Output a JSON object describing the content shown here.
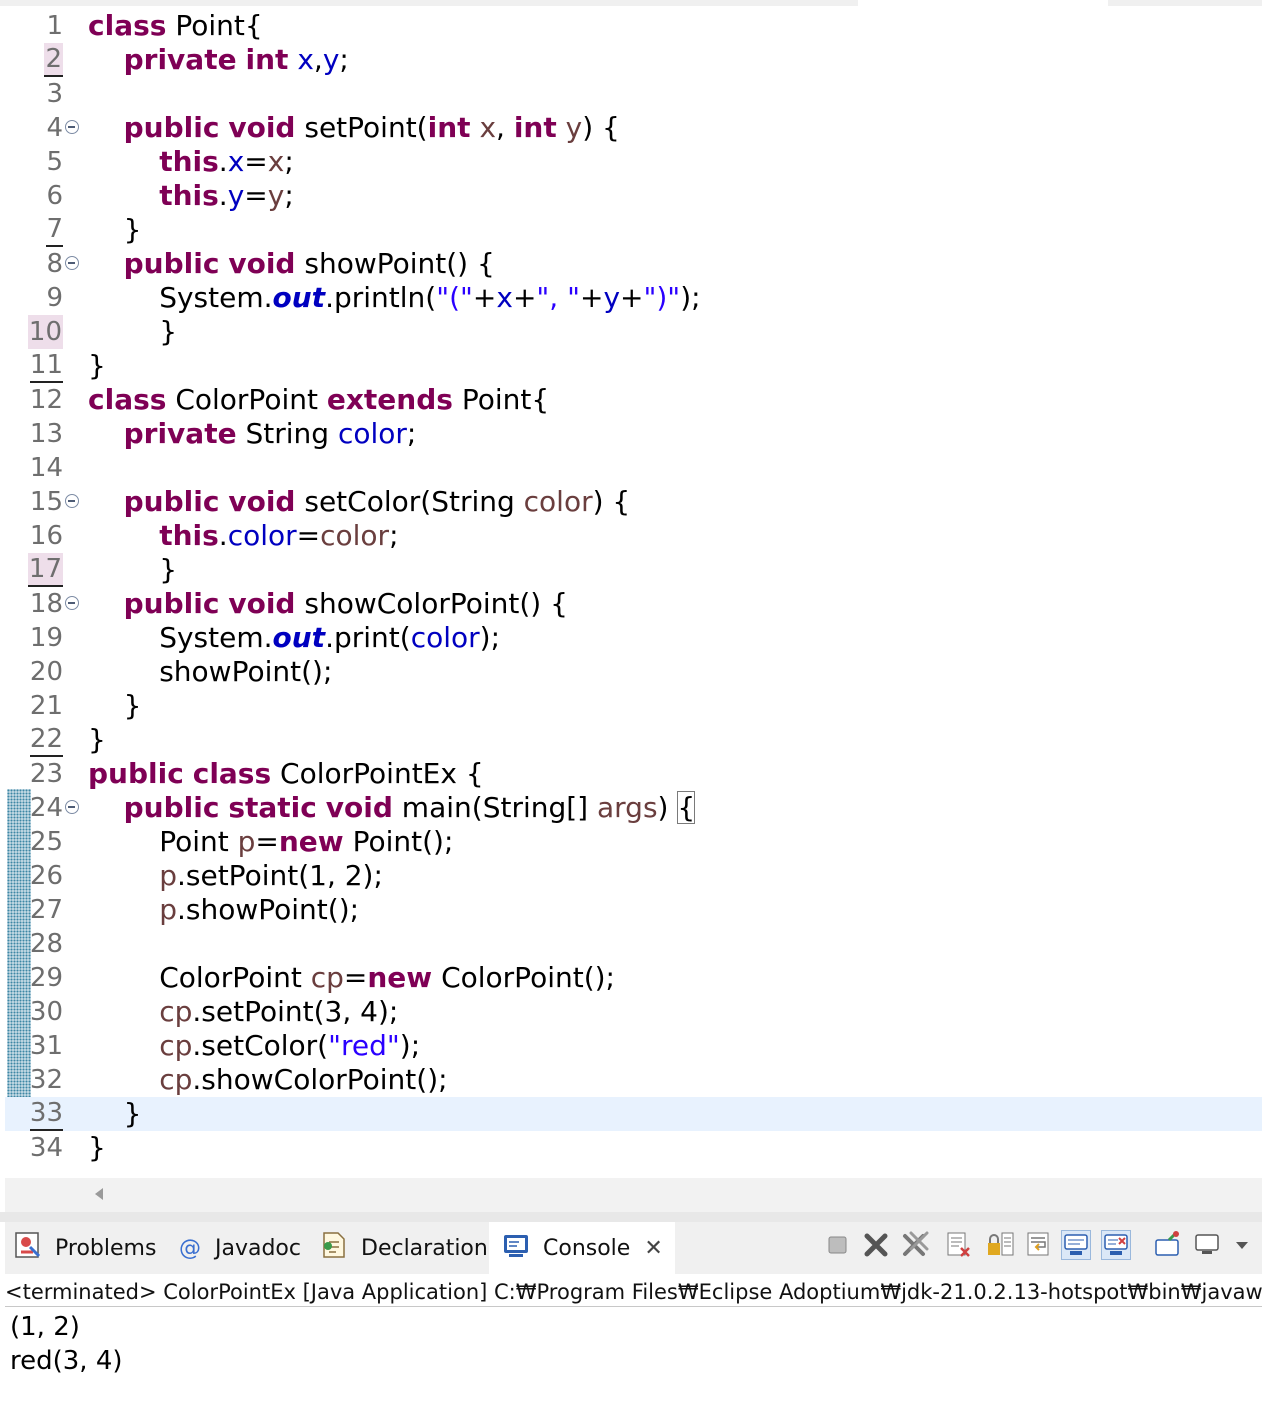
{
  "editor": {
    "current_line": 33,
    "lines": [
      {
        "n": "1",
        "tokens": [
          [
            "kw",
            "class"
          ],
          [
            "p",
            " Point{"
          ]
        ]
      },
      {
        "n": "2",
        "mark": true,
        "ul": true,
        "tokens": [
          [
            "p",
            "    "
          ],
          [
            "kw",
            "private"
          ],
          [
            "p",
            " "
          ],
          [
            "kw",
            "int"
          ],
          [
            "p",
            " "
          ],
          [
            "fld",
            "x"
          ],
          [
            "p",
            ","
          ],
          [
            "fld",
            "y"
          ],
          [
            "p",
            ";"
          ]
        ]
      },
      {
        "n": "3",
        "tokens": []
      },
      {
        "n": "4",
        "fold": true,
        "tokens": [
          [
            "p",
            "    "
          ],
          [
            "kw",
            "public"
          ],
          [
            "p",
            " "
          ],
          [
            "kw",
            "void"
          ],
          [
            "p",
            " setPoint("
          ],
          [
            "kw",
            "int"
          ],
          [
            "p",
            " "
          ],
          [
            "var",
            "x"
          ],
          [
            "p",
            ", "
          ],
          [
            "kw",
            "int"
          ],
          [
            "p",
            " "
          ],
          [
            "var",
            "y"
          ],
          [
            "p",
            ") {"
          ]
        ]
      },
      {
        "n": "5",
        "tokens": [
          [
            "p",
            "        "
          ],
          [
            "kw",
            "this"
          ],
          [
            "p",
            "."
          ],
          [
            "fld",
            "x"
          ],
          [
            "p",
            "="
          ],
          [
            "var",
            "x"
          ],
          [
            "p",
            ";"
          ]
        ]
      },
      {
        "n": "6",
        "tokens": [
          [
            "p",
            "        "
          ],
          [
            "kw",
            "this"
          ],
          [
            "p",
            "."
          ],
          [
            "fld",
            "y"
          ],
          [
            "p",
            "="
          ],
          [
            "var",
            "y"
          ],
          [
            "p",
            ";"
          ]
        ]
      },
      {
        "n": "7",
        "ul": true,
        "tokens": [
          [
            "p",
            "    }"
          ]
        ]
      },
      {
        "n": "8",
        "fold": true,
        "tokens": [
          [
            "p",
            "    "
          ],
          [
            "kw",
            "public"
          ],
          [
            "p",
            " "
          ],
          [
            "kw",
            "void"
          ],
          [
            "p",
            " showPoint() {"
          ]
        ]
      },
      {
        "n": "9",
        "tokens": [
          [
            "p",
            "        System."
          ],
          [
            "sfld",
            "out"
          ],
          [
            "p",
            ".println("
          ],
          [
            "str",
            "\"(\""
          ],
          [
            "p",
            "+"
          ],
          [
            "fld",
            "x"
          ],
          [
            "p",
            "+"
          ],
          [
            "str",
            "\", \""
          ],
          [
            "p",
            "+"
          ],
          [
            "fld",
            "y"
          ],
          [
            "p",
            "+"
          ],
          [
            "str",
            "\")\""
          ],
          [
            "p",
            ");"
          ]
        ]
      },
      {
        "n": "10",
        "mark": true,
        "tokens": [
          [
            "p",
            "        }"
          ]
        ]
      },
      {
        "n": "11",
        "ul": true,
        "tokens": [
          [
            "p",
            "}"
          ]
        ]
      },
      {
        "n": "12",
        "tokens": [
          [
            "kw",
            "class"
          ],
          [
            "p",
            " ColorPoint "
          ],
          [
            "kw",
            "extends"
          ],
          [
            "p",
            " Point{"
          ]
        ]
      },
      {
        "n": "13",
        "tokens": [
          [
            "p",
            "    "
          ],
          [
            "kw",
            "private"
          ],
          [
            "p",
            " String "
          ],
          [
            "fld",
            "color"
          ],
          [
            "p",
            ";"
          ]
        ]
      },
      {
        "n": "14",
        "tokens": []
      },
      {
        "n": "15",
        "fold": true,
        "tokens": [
          [
            "p",
            "    "
          ],
          [
            "kw",
            "public"
          ],
          [
            "p",
            " "
          ],
          [
            "kw",
            "void"
          ],
          [
            "p",
            " setColor(String "
          ],
          [
            "var",
            "color"
          ],
          [
            "p",
            ") {"
          ]
        ]
      },
      {
        "n": "16",
        "tokens": [
          [
            "p",
            "        "
          ],
          [
            "kw",
            "this"
          ],
          [
            "p",
            "."
          ],
          [
            "fld",
            "color"
          ],
          [
            "p",
            "="
          ],
          [
            "var",
            "color"
          ],
          [
            "p",
            ";"
          ]
        ]
      },
      {
        "n": "17",
        "mark": true,
        "ul": true,
        "tokens": [
          [
            "p",
            "        }"
          ]
        ]
      },
      {
        "n": "18",
        "fold": true,
        "tokens": [
          [
            "p",
            "    "
          ],
          [
            "kw",
            "public"
          ],
          [
            "p",
            " "
          ],
          [
            "kw",
            "void"
          ],
          [
            "p",
            " showColorPoint() {"
          ]
        ]
      },
      {
        "n": "19",
        "tokens": [
          [
            "p",
            "        System."
          ],
          [
            "sfld",
            "out"
          ],
          [
            "p",
            ".print("
          ],
          [
            "fld",
            "color"
          ],
          [
            "p",
            ");"
          ]
        ]
      },
      {
        "n": "20",
        "tokens": [
          [
            "p",
            "        showPoint();"
          ]
        ]
      },
      {
        "n": "21",
        "tokens": [
          [
            "p",
            "    }"
          ]
        ]
      },
      {
        "n": "22",
        "ul": true,
        "tokens": [
          [
            "p",
            "}"
          ]
        ]
      },
      {
        "n": "23",
        "tokens": [
          [
            "kw",
            "public"
          ],
          [
            "p",
            " "
          ],
          [
            "kw",
            "class"
          ],
          [
            "p",
            " ColorPointEx {"
          ]
        ]
      },
      {
        "n": "24",
        "fold": true,
        "tokens": [
          [
            "p",
            "    "
          ],
          [
            "kw",
            "public"
          ],
          [
            "p",
            " "
          ],
          [
            "kw",
            "static"
          ],
          [
            "p",
            " "
          ],
          [
            "kw",
            "void"
          ],
          [
            "p",
            " main(String[] "
          ],
          [
            "var",
            "args"
          ],
          [
            "p",
            ") "
          ],
          [
            "brace",
            "{"
          ]
        ]
      },
      {
        "n": "25",
        "tokens": [
          [
            "p",
            "        Point "
          ],
          [
            "var",
            "p"
          ],
          [
            "p",
            "="
          ],
          [
            "kw",
            "new"
          ],
          [
            "p",
            " Point();"
          ]
        ]
      },
      {
        "n": "26",
        "tokens": [
          [
            "p",
            "        "
          ],
          [
            "var",
            "p"
          ],
          [
            "p",
            ".setPoint(1, 2);"
          ]
        ]
      },
      {
        "n": "27",
        "tokens": [
          [
            "p",
            "        "
          ],
          [
            "var",
            "p"
          ],
          [
            "p",
            ".showPoint();"
          ]
        ]
      },
      {
        "n": "28",
        "tokens": []
      },
      {
        "n": "29",
        "tokens": [
          [
            "p",
            "        ColorPoint "
          ],
          [
            "var",
            "cp"
          ],
          [
            "p",
            "="
          ],
          [
            "kw",
            "new"
          ],
          [
            "p",
            " ColorPoint();"
          ]
        ]
      },
      {
        "n": "30",
        "tokens": [
          [
            "p",
            "        "
          ],
          [
            "var",
            "cp"
          ],
          [
            "p",
            ".setPoint(3, 4);"
          ]
        ]
      },
      {
        "n": "31",
        "tokens": [
          [
            "p",
            "        "
          ],
          [
            "var",
            "cp"
          ],
          [
            "p",
            ".setColor("
          ],
          [
            "str",
            "\"red\""
          ],
          [
            "p",
            ");"
          ]
        ]
      },
      {
        "n": "32",
        "tokens": [
          [
            "p",
            "        "
          ],
          [
            "var",
            "cp"
          ],
          [
            "p",
            ".showColorPoint();"
          ]
        ]
      },
      {
        "n": "33",
        "ul": true,
        "tokens": [
          [
            "p",
            "    }"
          ]
        ]
      },
      {
        "n": "34",
        "tokens": [
          [
            "p",
            "}"
          ]
        ]
      }
    ]
  },
  "panel": {
    "tabs": [
      {
        "label": "Problems",
        "icon": "problems-icon"
      },
      {
        "label": "Javadoc",
        "icon": "javadoc-icon"
      },
      {
        "label": "Declaration",
        "icon": "declaration-icon"
      },
      {
        "label": "Console",
        "icon": "console-icon",
        "active": true,
        "close": "✕"
      }
    ],
    "toolbar_icons": [
      "terminate-icon",
      "remove-launch-icon",
      "remove-all-terminated-icon",
      "clear-console-icon",
      "scroll-lock-icon",
      "word-wrap-icon",
      "show-on-stdout-icon",
      "show-on-stderr-icon",
      "pin-console-icon",
      "display-console-icon",
      "view-menu-icon"
    ],
    "status": "<terminated> ColorPointEx [Java Application] C:₩Program Files₩Eclipse Adoptium₩jdk-21.0.2.13-hotspot₩bin₩javaw",
    "output": [
      "(1, 2)",
      "red(3, 4)"
    ]
  },
  "colors": {
    "keyword": "#7f0055",
    "field": "#0000c0",
    "string": "#2a00ff",
    "local": "#6a3e3e",
    "current_line": "#e8f2fe"
  }
}
